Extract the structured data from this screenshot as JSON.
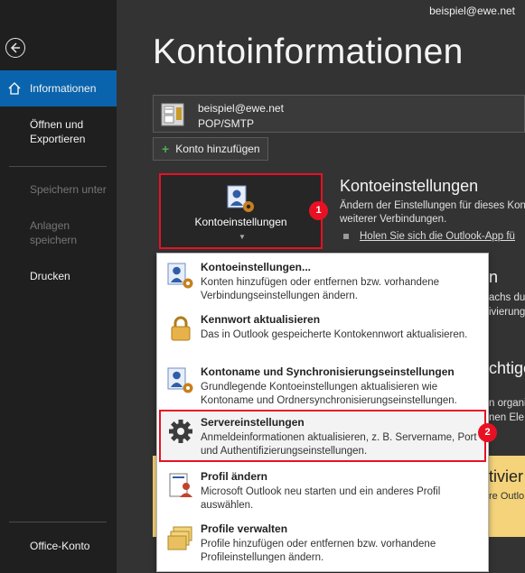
{
  "sidebar": {
    "items": [
      {
        "label": "Informationen"
      },
      {
        "label": "Öffnen und Exportieren"
      },
      {
        "label": "Speichern unter"
      },
      {
        "label": "Anlagen speichern"
      },
      {
        "label": "Drucken"
      }
    ],
    "bottom_item": "Office-Konto"
  },
  "header": {
    "account_email": "beispiel@ewe.net",
    "title": "Kontoinformationen"
  },
  "account": {
    "email": "beispiel@ewe.net",
    "type": "POP/SMTP",
    "add_label": "Konto hinzufügen"
  },
  "account_settings": {
    "button_label": "Kontoeinstellungen",
    "section_title": "Kontoeinstellungen",
    "section_desc_1": "Ändern der Einstellungen für dieses Kon",
    "section_desc_2": "weiterer Verbindungen.",
    "section_link": "Holen Sie sich die Outlook-App fü"
  },
  "background_partial": {
    "heading_1": "n",
    "line_1a": "achs du",
    "line_1b": "ivierung",
    "heading_2": "chtige",
    "line_2a": "n organi",
    "line_2b": "nen Ele",
    "yellow_heading": "tivier",
    "yellow_line": "re Outlo"
  },
  "badges": [
    "1",
    "2"
  ],
  "dropdown": {
    "items": [
      {
        "title": "Kontoeinstellungen...",
        "desc": "Konten hinzufügen oder entfernen bzw. vorhandene Verbindungseinstellungen ändern.",
        "icon": "account-settings-icon"
      },
      {
        "title": "Kennwort aktualisieren",
        "desc": "Das in Outlook gespeicherte Kontokennwort aktualisieren.",
        "icon": "lock-icon"
      },
      {
        "title": "Kontoname und Synchronisierungseinstellungen",
        "desc": "Grundlegende Kontoeinstellungen aktualisieren wie Kontoname und Ordnersynchronisierungseinstellungen.",
        "icon": "account-sync-icon"
      },
      {
        "title": "Servereinstellungen",
        "desc": "Anmeldeinformationen aktualisieren, z. B. Servername, Port und Authentifizierungseinstellungen.",
        "icon": "gear-icon"
      },
      {
        "title": "Profil ändern",
        "desc": "Microsoft Outlook neu starten und ein anderes Profil auswählen.",
        "icon": "profile-icon"
      },
      {
        "title": "Profile verwalten",
        "desc": "Profile hinzufügen oder entfernen bzw. vorhandene Profileinstellungen ändern.",
        "icon": "folders-icon"
      }
    ]
  },
  "colors": {
    "accent": "#0a64ad",
    "highlight": "#e81123",
    "sidebar": "#1f1f1f",
    "main": "#333333"
  }
}
